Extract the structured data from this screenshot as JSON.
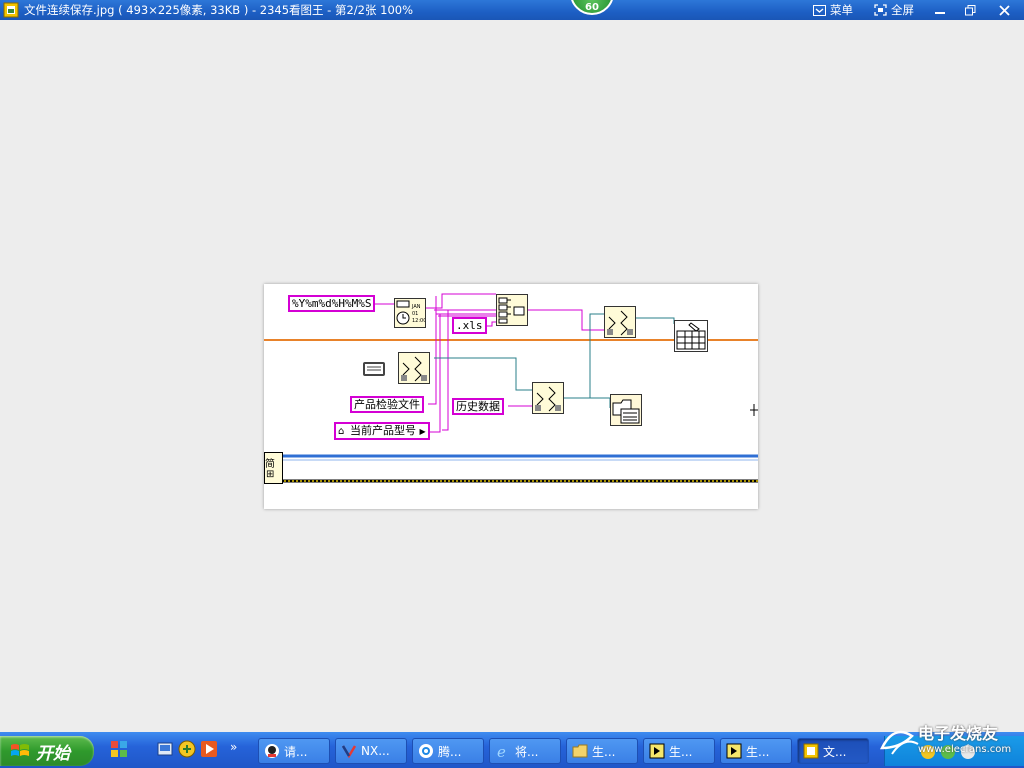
{
  "window": {
    "title": "文件连续保存.jpg ( 493×225像素, 33KB ) - 2345看图王 - 第2/2张 100%",
    "badge": "60",
    "menu_label": "菜单",
    "fullscreen_label": "全屏"
  },
  "diagram": {
    "format_string": "%Y%m%d%H%M%S",
    "extension": ".xls",
    "label_inspection_file": "产品检验文件",
    "label_history": "历史数据",
    "label_current_model": "当前产品型号",
    "left_fragment": "简"
  },
  "taskbar": {
    "start_label": "开始",
    "more": "»",
    "tasks": [
      {
        "label": "请..."
      },
      {
        "label": "NX..."
      },
      {
        "label": "腾..."
      },
      {
        "label": "将..."
      },
      {
        "label": "生..."
      },
      {
        "label": "生..."
      },
      {
        "label": "生..."
      },
      {
        "label": "文..."
      }
    ],
    "watermark": "电子发烧友",
    "watermark_url": "www.elecfans.com"
  },
  "colors": {
    "titlebar": "#1d5fc4",
    "taskbar": "#2663d9",
    "start": "#2f9a2c",
    "wire_pink": "#d400d4",
    "wire_orange": "#e8822a",
    "wire_teal": "#2a7f8a",
    "wire_blue": "#2f6fd4"
  }
}
